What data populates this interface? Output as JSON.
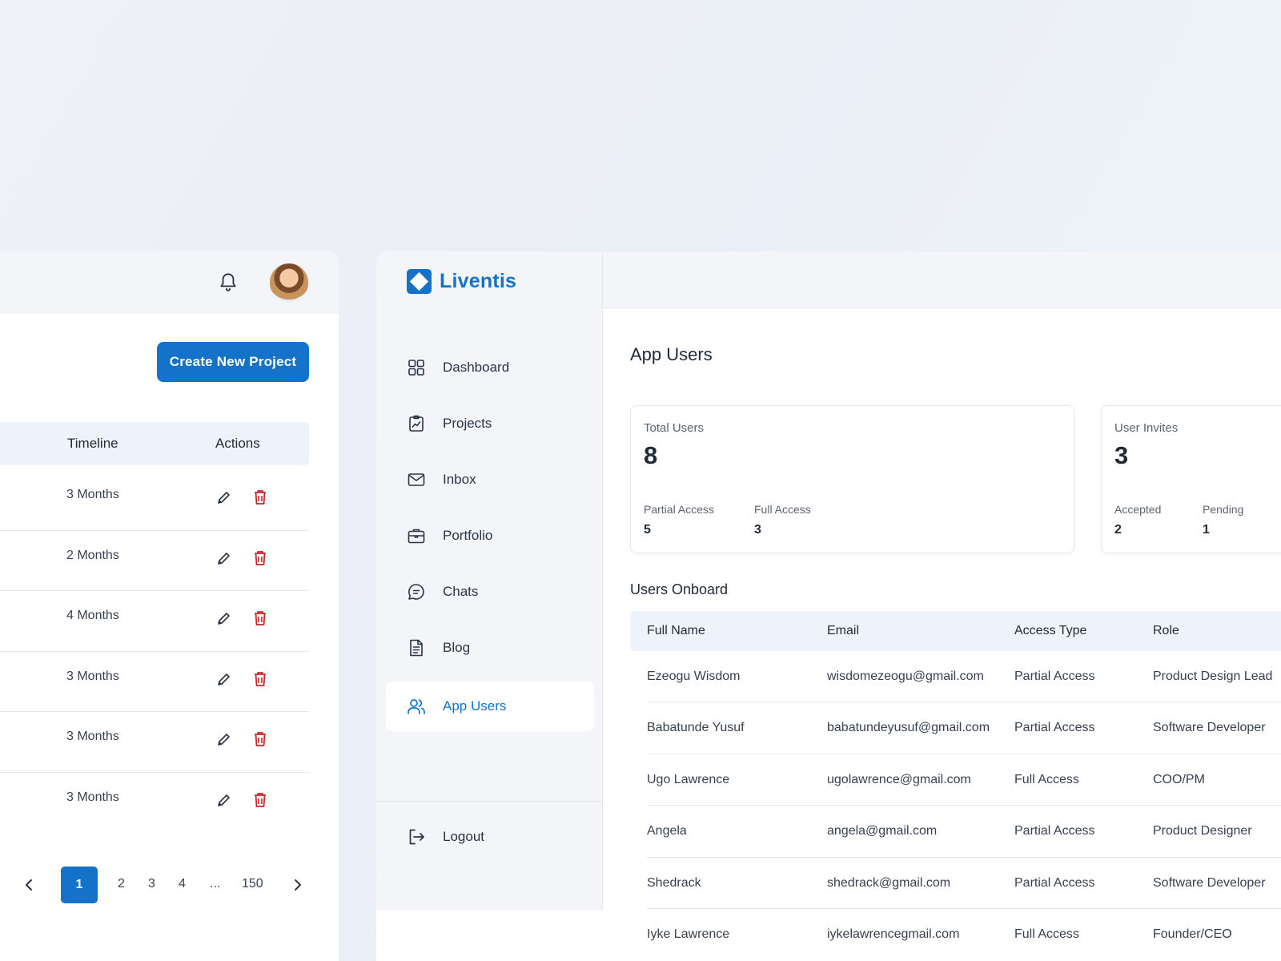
{
  "projects_panel": {
    "create_button": "Create New Project",
    "columns": {
      "timeline": "Timeline",
      "actions": "Actions"
    },
    "rows": [
      {
        "timeline": "3 Months"
      },
      {
        "timeline": "2 Months"
      },
      {
        "timeline": "4 Months"
      },
      {
        "timeline": "3 Months"
      },
      {
        "timeline": "3 Months"
      },
      {
        "timeline": "3 Months"
      }
    ],
    "pagination": {
      "current": "1",
      "pages": [
        "2",
        "3",
        "4"
      ],
      "ellipsis": "...",
      "last": "150"
    }
  },
  "brand": {
    "name": "Liventis",
    "color": "#1572c9"
  },
  "sidebar": {
    "items": [
      {
        "label": "Dashboard",
        "icon": "grid-icon"
      },
      {
        "label": "Projects",
        "icon": "clipboard-chart-icon"
      },
      {
        "label": "Inbox",
        "icon": "mail-icon"
      },
      {
        "label": "Portfolio",
        "icon": "briefcase-icon"
      },
      {
        "label": "Chats",
        "icon": "chat-bubble-icon"
      },
      {
        "label": "Blog",
        "icon": "document-icon"
      },
      {
        "label": "App Users",
        "icon": "users-icon",
        "active": true
      }
    ],
    "logout": "Logout"
  },
  "main": {
    "title": "App Users",
    "cards": {
      "total": {
        "label": "Total Users",
        "value": "8",
        "sub1_label": "Partial Access",
        "sub1_value": "5",
        "sub2_label": "Full Access",
        "sub2_value": "3"
      },
      "invites": {
        "label": "User Invites",
        "value": "3",
        "sub1_label": "Accepted",
        "sub1_value": "2",
        "sub2_label": "Pending",
        "sub2_value": "1"
      }
    },
    "section_title": "Users Onboard",
    "table": {
      "columns": [
        "Full Name",
        "Email",
        "Access Type",
        "Role"
      ],
      "rows": [
        [
          "Ezeogu Wisdom",
          "wisdomezeogu@gmail.com",
          "Partial Access",
          "Product Design Lead"
        ],
        [
          "Babatunde Yusuf",
          "babatundeyusuf@gmail.com",
          "Partial Access",
          "Software Developer"
        ],
        [
          "Ugo Lawrence",
          "ugolawrence@gmail.com",
          "Full Access",
          "COO/PM"
        ],
        [
          "Angela",
          "angela@gmail.com",
          "Partial Access",
          "Product Designer"
        ],
        [
          "Shedrack",
          "shedrack@gmail.com",
          "Partial Access",
          "Software Developer"
        ],
        [
          "Iyke Lawrence",
          "iykelawrencegmail.com",
          "Full Access",
          "Founder/CEO"
        ]
      ]
    }
  },
  "colors": {
    "accent": "#1572c9",
    "danger": "#c62828",
    "header_bg": "#ecf3fb"
  }
}
